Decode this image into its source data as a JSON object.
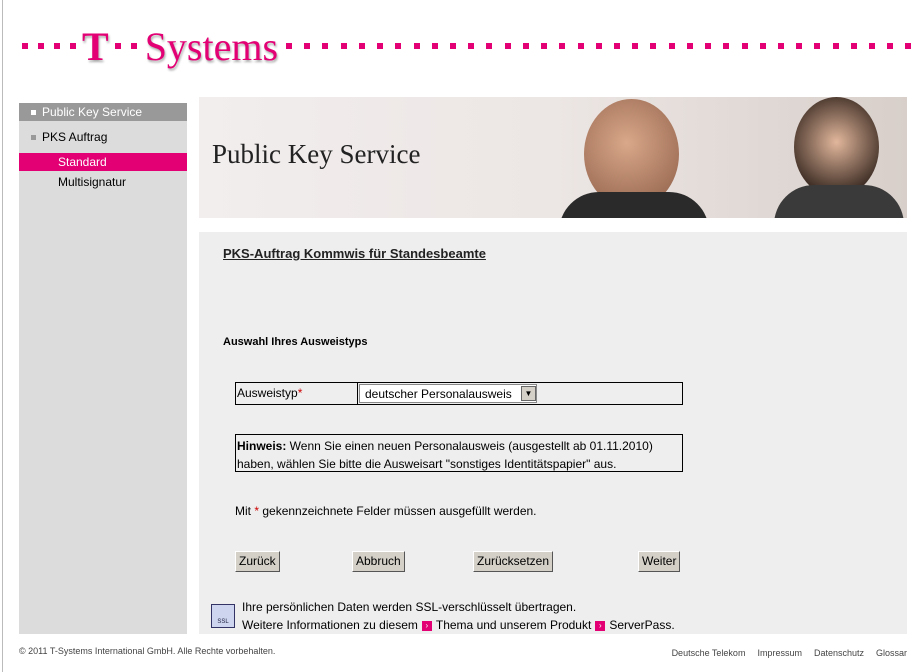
{
  "brand": {
    "logo_text": "T··Systems",
    "accent": "#e20074"
  },
  "sidebar": {
    "items": [
      {
        "label": "Public Key Service"
      },
      {
        "label": "PKS Auftrag"
      },
      {
        "label": "Standard",
        "active": true
      },
      {
        "label": "Multisignatur"
      }
    ]
  },
  "banner": {
    "title": "Public Key Service"
  },
  "form": {
    "title": "PKS-Auftrag Kommwis für Standesbeamte",
    "section": "Auswahl Ihres Ausweistyps",
    "field_label": "Ausweistyp",
    "required_mark": "*",
    "select_value": "deutscher Personalausweis",
    "hint_label": "Hinweis:",
    "hint_text": " Wenn Sie einen neuen Personalausweis (ausgestellt ab 01.11.2010) haben, wählen Sie bitte die Ausweisart \"sonstiges Identitätspapier\" aus.",
    "mandatory_pre": "Mit ",
    "mandatory_post": " gekennzeichnete Felder müssen ausgefüllt werden.",
    "buttons": {
      "back": "Zurück",
      "cancel": "Abbruch",
      "reset": "Zurücksetzen",
      "next": "Weiter"
    }
  },
  "ssl": {
    "icon_label": "SSL",
    "line1": "Ihre persönlichen Daten werden SSL-verschlüsselt übertragen.",
    "line2_a": "Weitere Informationen zu diesem",
    "link1": "Thema",
    "line2_b": "und unserem Produkt",
    "link2": "ServerPass."
  },
  "footer": {
    "copyright": "© 2011 T-Systems International GmbH. Alle Rechte vorbehalten.",
    "links": [
      "Deutsche Telekom",
      "Impressum",
      "Datenschutz",
      "Glossar"
    ]
  }
}
